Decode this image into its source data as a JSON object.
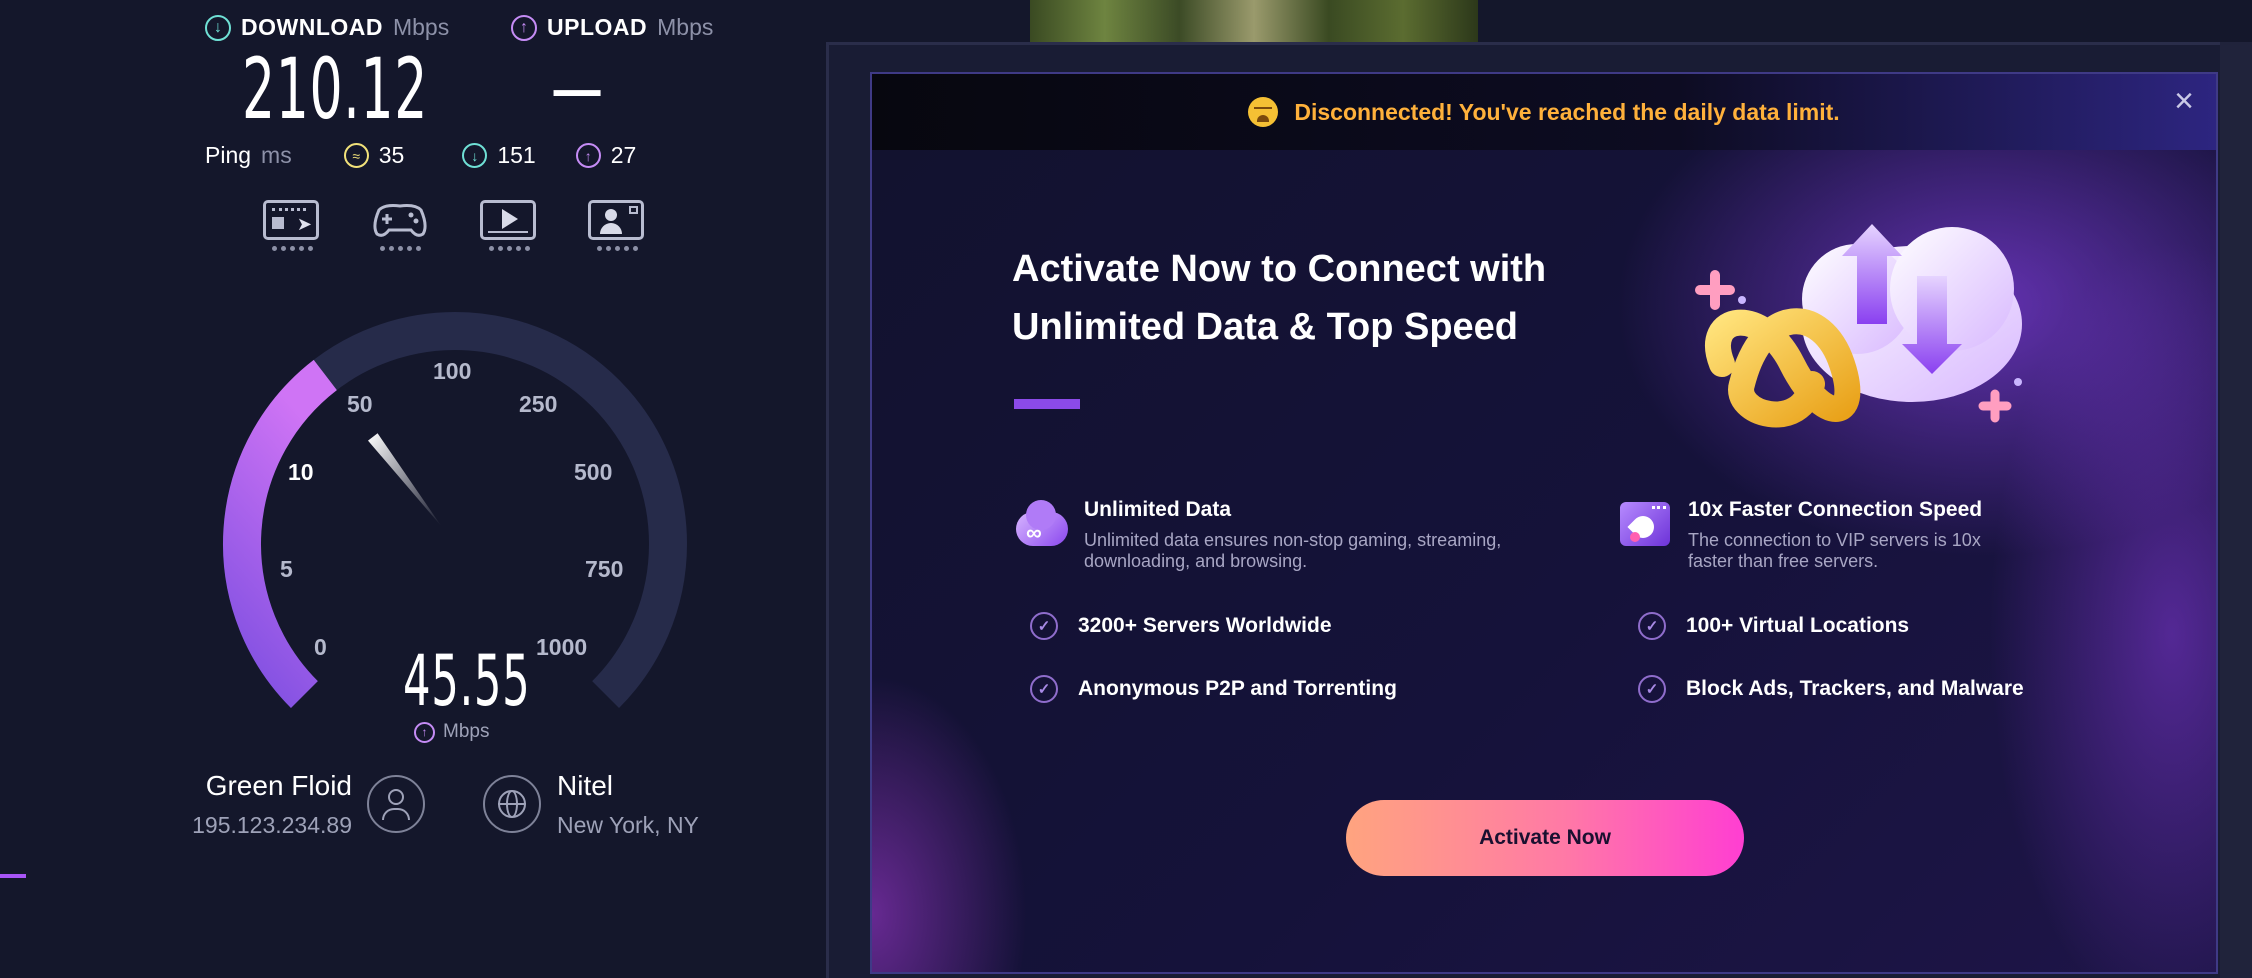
{
  "speedtest": {
    "download": {
      "label": "DOWNLOAD",
      "unit": "Mbps",
      "value": "210.12"
    },
    "upload": {
      "label": "UPLOAD",
      "unit": "Mbps",
      "value": "—"
    },
    "ping": {
      "label": "Ping",
      "unit": "ms",
      "idle": "35",
      "down": "151",
      "up": "27"
    },
    "service_icons": [
      "browsing-icon",
      "gaming-icon",
      "streaming-icon",
      "video-call-icon"
    ],
    "gauge": {
      "ticks": [
        "0",
        "5",
        "10",
        "50",
        "100",
        "250",
        "500",
        "750",
        "1000"
      ],
      "current_value": 45.55,
      "current_label": "45.55",
      "unit": "Mbps",
      "accent_color": "#c06cf2"
    },
    "client": {
      "name": "Green Floid",
      "ip": "195.123.234.89"
    },
    "server": {
      "name": "Nitel",
      "location": "New York, NY"
    }
  },
  "modal": {
    "banner": "Disconnected! You've reached the daily data limit.",
    "close_icon": "close-icon",
    "title_line1": "Activate Now to Connect with",
    "title_line2": "Unlimited Data & Top Speed",
    "features": [
      {
        "title": "Unlimited Data",
        "desc_line1": "Unlimited data ensures non-stop gaming, streaming,",
        "desc_line2": "downloading, and browsing.",
        "icon": "cloud-infinity-icon"
      },
      {
        "title": "10x Faster Connection Speed",
        "desc_line1": "The connection to VIP servers is 10x",
        "desc_line2": "faster than free servers.",
        "icon": "rocket-window-icon"
      }
    ],
    "checks": [
      "3200+ Servers Worldwide",
      "100+ Virtual Locations",
      "Anonymous P2P and Torrenting",
      "Block Ads, Trackers, and Malware"
    ],
    "cta": "Activate Now",
    "banner_text_color": "#ffb13b",
    "cta_gradient": [
      "#ffa47f",
      "#ff3ed2"
    ]
  }
}
